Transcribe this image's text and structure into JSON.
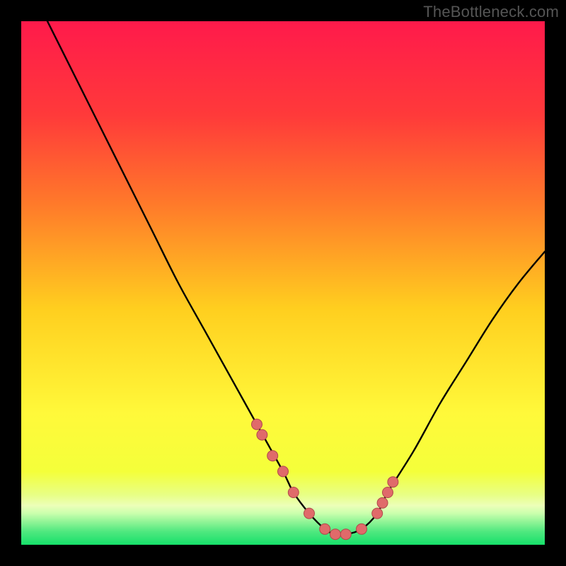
{
  "watermark": "TheBottleneck.com",
  "colors": {
    "background": "#000000",
    "gradient_top": "#ff1a4b",
    "gradient_mid_upper": "#ff6a2a",
    "gradient_mid": "#ffd21f",
    "gradient_lower": "#f4ff3a",
    "gradient_band": "#e8ff86",
    "gradient_bottom": "#16e06a",
    "curve": "#000000",
    "marker": "#e06a6a",
    "marker_stroke": "#b04a4a"
  },
  "chart_data": {
    "type": "line",
    "title": "",
    "xlabel": "",
    "ylabel": "",
    "xlim": [
      0,
      100
    ],
    "ylim": [
      0,
      100
    ],
    "series": [
      {
        "name": "bottleneck-curve",
        "x": [
          5,
          10,
          15,
          20,
          25,
          30,
          35,
          40,
          45,
          50,
          52,
          55,
          58,
          60,
          62,
          65,
          68,
          70,
          75,
          80,
          85,
          90,
          95,
          100
        ],
        "y": [
          100,
          90,
          80,
          70,
          60,
          50,
          41,
          32,
          23,
          14,
          10,
          6,
          3,
          2,
          2,
          3,
          6,
          10,
          18,
          27,
          35,
          43,
          50,
          56
        ]
      }
    ],
    "markers": {
      "name": "highlight-points",
      "x": [
        45,
        46,
        48,
        50,
        52,
        55,
        58,
        60,
        62,
        65,
        68,
        69,
        70,
        71
      ],
      "y": [
        23,
        21,
        17,
        14,
        10,
        6,
        3,
        2,
        2,
        3,
        6,
        8,
        10,
        12
      ]
    }
  }
}
